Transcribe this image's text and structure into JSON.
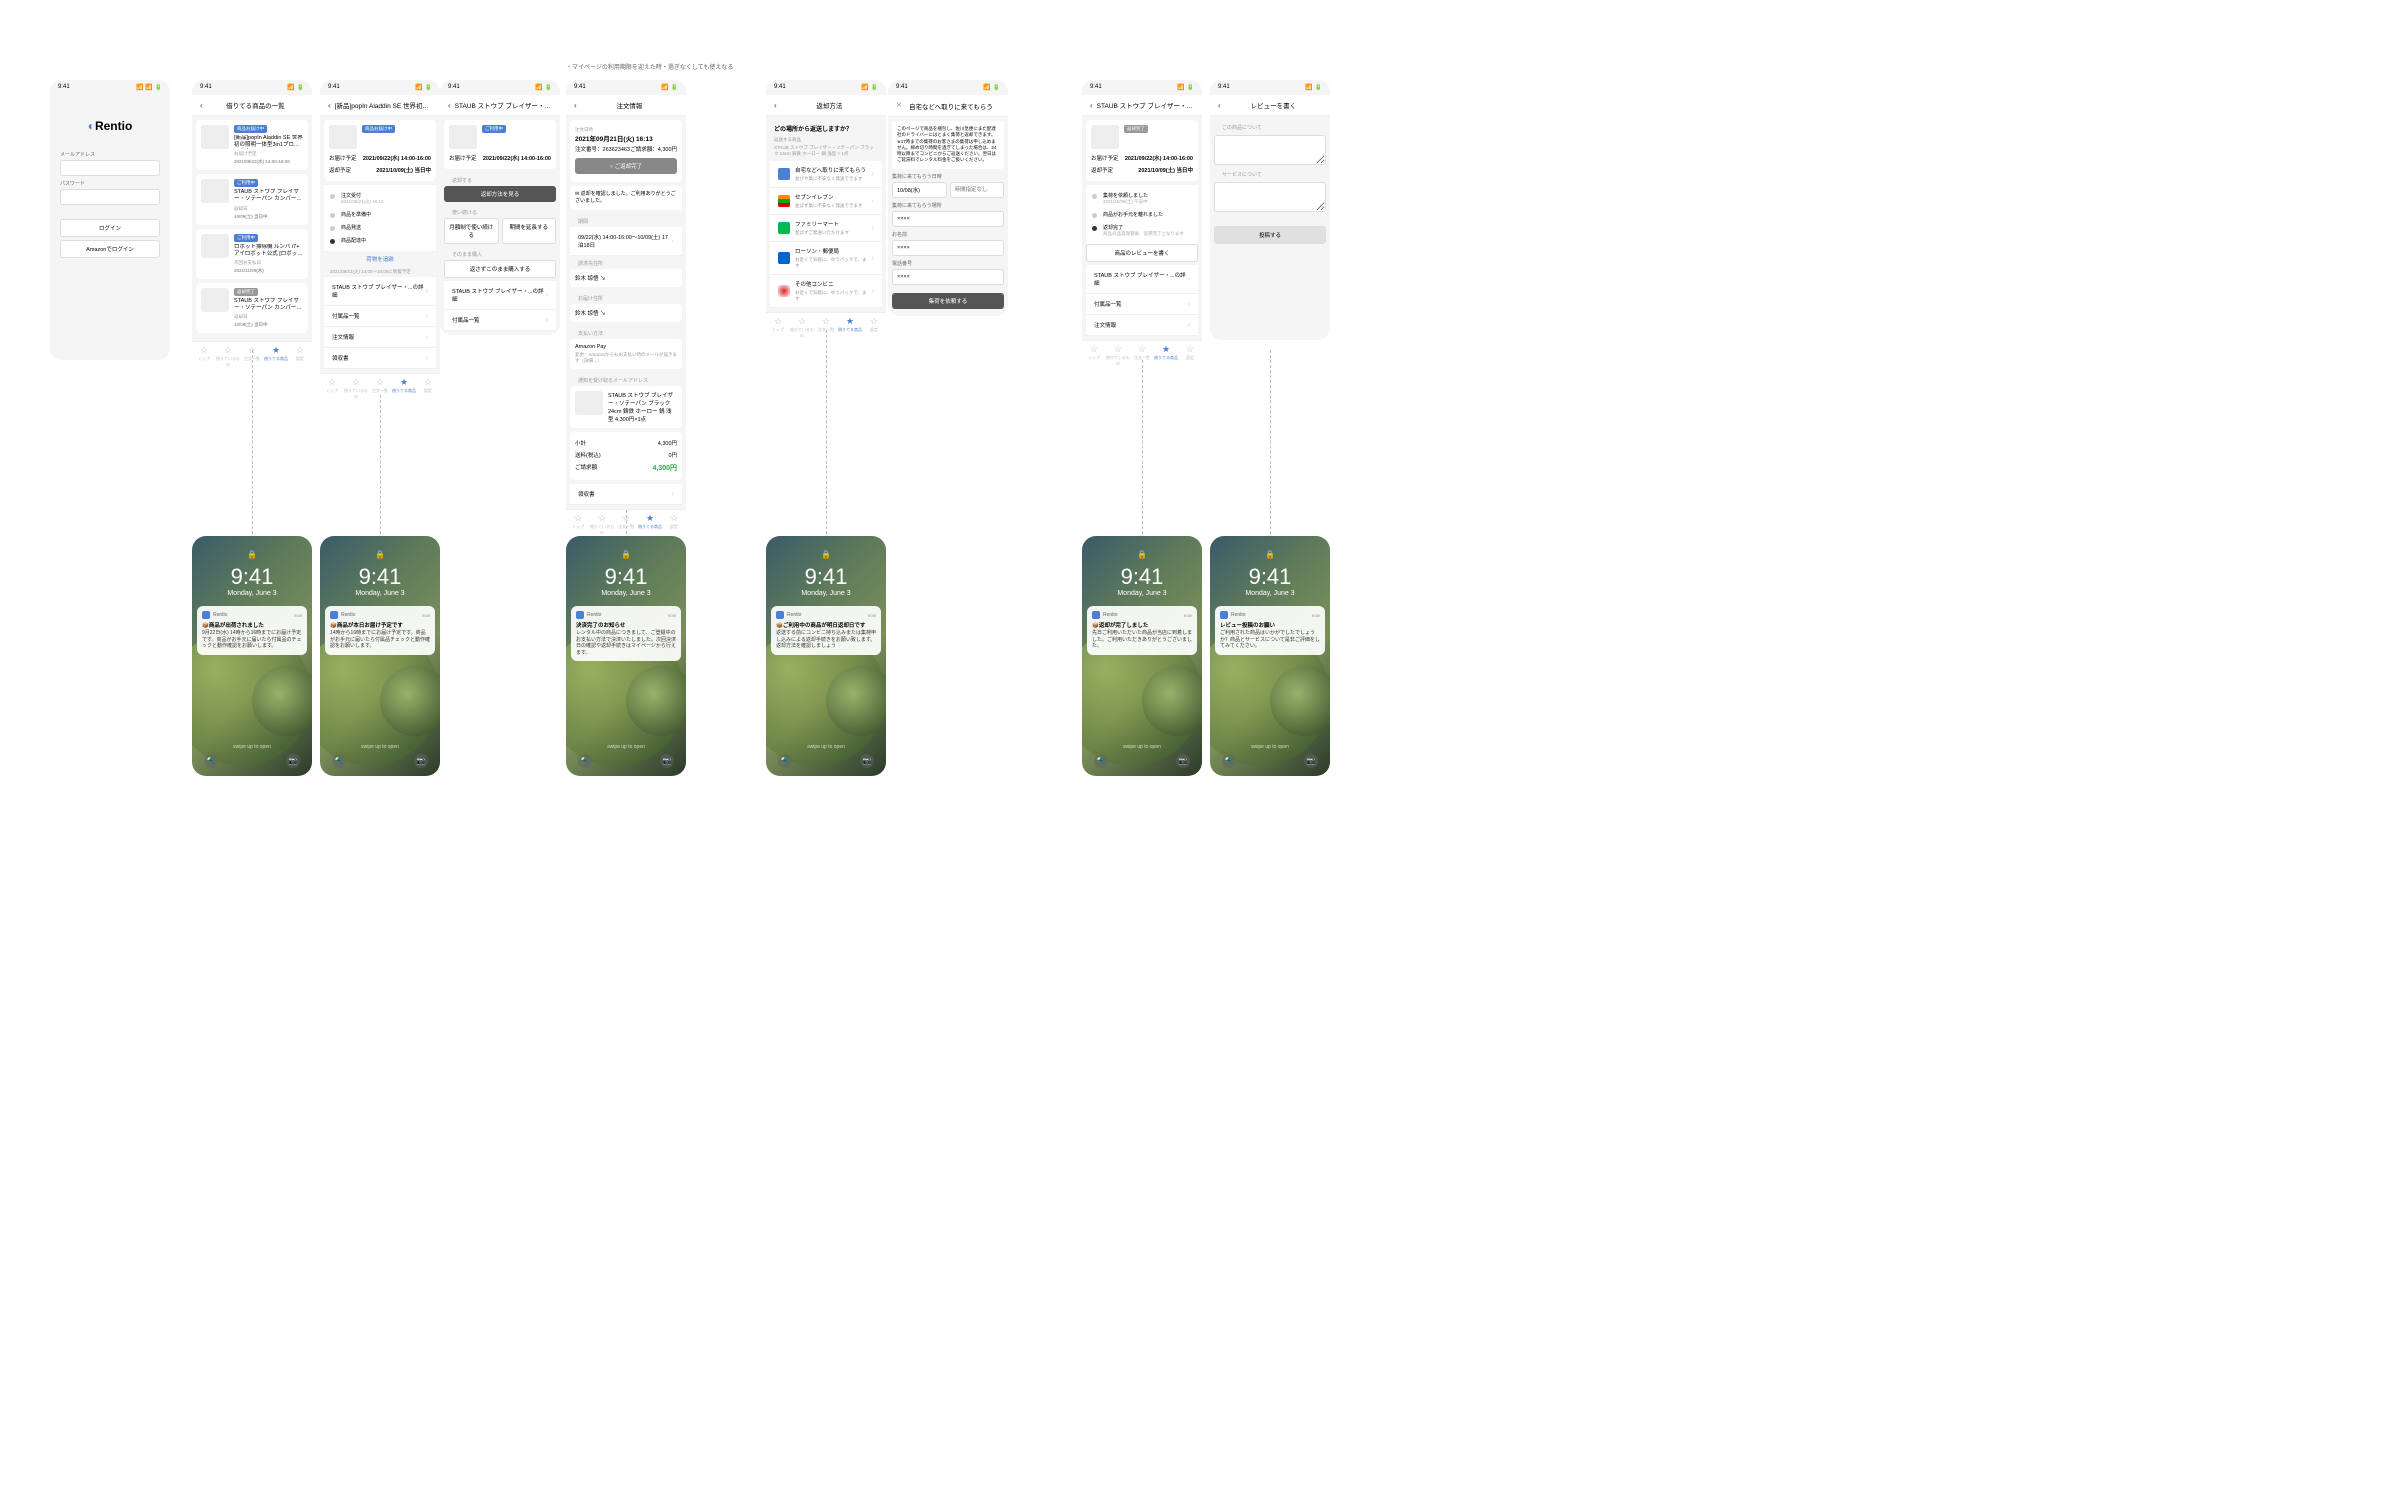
{
  "status_time": "9:41",
  "app_name": "Rentio",
  "annotation": "・マイページの利用期限を迎えた時・過ぎなくしても使えなる",
  "login": {
    "email_label": "メールアドレス",
    "password_label": "パスワード",
    "login_btn": "ログイン",
    "amazon_btn": "Amazonでログイン"
  },
  "list": {
    "title": "借りてる商品の一覧",
    "items": [
      {
        "badge": "商品お届け中",
        "name": "[新品]popIn Aladdin SE 世界初の照明一体型3in1プロジェクター PA20U02DJ",
        "sub1": "お届け予定",
        "sub2": "2021/09/22(水) 14:00-16:00"
      },
      {
        "badge": "ご利用中",
        "name": "STAUB ストウブ ブレイザー・ソテーパン カンパーニュ28c...",
        "sub1": "返却日",
        "sub2": "10/09(土) 当日中"
      },
      {
        "badge": "ご利用中",
        "name": "ロボット掃除機 ルンバ i7+ アイロボット公式 [ロボットスマー...",
        "sub1": "次回お支払日",
        "sub2": "2021/11/09(木)"
      },
      {
        "badge": "返却完了",
        "name": "STAUB ストウブ ブレイザー・ソテーパン カンパーニュ28c...",
        "sub1": "返却日",
        "sub2": "10/09(土) 当日中"
      }
    ]
  },
  "detail_a": {
    "title": "[新品]popIn Aladdin SE 世界初の照...",
    "badge": "商品お届け中",
    "deliver_label": "お届け予定",
    "deliver_val": "2021/09/22(水) 14:00-16:00",
    "return_label": "返却予定",
    "return_val": "2021/10/09(土) 当日中",
    "timeline": [
      {
        "s": "注文受付",
        "d": "2021/09/21(火) 16:13"
      },
      {
        "s": "商品を準備中",
        "d": ""
      },
      {
        "s": "商品発送",
        "d": ""
      },
      {
        "s": "商品配達中",
        "d": ""
      }
    ],
    "track": "荷物を追跡",
    "arrive": "2021/09/21(火) 14:00～16:00に到着予定",
    "more": "STAUB ストウブ ブレイザー・...の詳細",
    "accessories": "付属品一覧",
    "order_info": "注文情報",
    "receipt": "領収書"
  },
  "detail_b": {
    "title": "STAUB ストウブ ブレイザー・ソテーパ...",
    "badge": "ご利用中",
    "return_btn": "返却する",
    "return_method": "返却方法を見る",
    "continue": "使い続ける",
    "g1": "月額制で使い続ける",
    "g2": "期間を延長する",
    "buy": "そのまま購入",
    "buy_btn": "返さずこのまま購入する",
    "more": "STAUB ストウブ ブレイザー・...の詳細",
    "accessories": "付属品一覧"
  },
  "order": {
    "title": "注文情報",
    "dt_label": "注文日時",
    "dt": "2021年09月21日(火) 16:13",
    "no_label": "注文番号：",
    "no": "263623463",
    "amt_label": "ご請求額：",
    "amt": "4,300円",
    "status_btn": "○ ご返却完了",
    "thanks": "✉ 返却を確認しました。ご利用ありがとうございました。",
    "period_label": "期間",
    "period": "09/22(水) 14:00-16:00〜10/09(土) 17泊18日",
    "bill_to": "請求先住所",
    "name1": "鈴木 諒悟 ↘",
    "ship_to": "お届け住所",
    "name2": "鈴木 諒悟 ↘",
    "pay": "支払い方法",
    "pay_method": "Amazon Pay",
    "pay_note": "変更：Amazonからもお支払い時のメールが届きます（詳細→）",
    "notify": "通知を受け取るメールアドレス",
    "item": "STAUB ストウブ ブレイザー・ソテーパン ブラック 24cm 鋳鉄 ホーロー 鍋 浅型 4,300円×1点",
    "p1": "小計",
    "p1v": "4,300円",
    "p2": "送料(税込)",
    "p2v": "0円",
    "p3": "ご請求額",
    "p3v": "4,300円",
    "receipt": "領収書"
  },
  "return": {
    "title": "返却方法",
    "q": "どの場所から返送しますか？",
    "sub": "返送する商品",
    "prod": "STAUB ストウブ ブレイザー・ソテーパン ブラック 24cm 鋳鉄 ホーロー 鍋 浅型 × 1点",
    "options": [
      {
        "t": "自宅などへ取りに来てもらう",
        "s": "並びや集に不安なく発送できます"
      },
      {
        "t": "セブンイレブン",
        "s": "並ばず集に不安なく発送できます"
      },
      {
        "t": "ファミリーマート",
        "s": "並ばずご発送いただけます"
      },
      {
        "t": "ローソン・郵便局",
        "s": "お近くで気軽に、ゆうパックで、ます"
      },
      {
        "t": "その他コンビニ",
        "s": "お近くで気軽に、ゆうパックで、ます"
      }
    ]
  },
  "pickup": {
    "title": "自宅などへ取りに来てもらう",
    "desc": "このページで商品を梱包し、佐川急便にまた配達社のドライバーにはとまく集荷と返却できます。\n※17時までの集荷のお客さまの集荷は申し込めません。締め切り時間を過ぎてしまった場合は、24時以降までコンビニからご返送ください。翌日はご延滞料でレンタル料金をご扱いください。",
    "date_label": "集荷に来てもらう日時",
    "date_val": "10/08(水)",
    "time_ph": "時間指定なし",
    "place_label": "集荷に来てもらう場所",
    "place_val": "××××",
    "name_label": "お名前",
    "name_val": "××××",
    "tel_label": "電話番号",
    "tel_val": "××××",
    "submit": "集荷を依頼する"
  },
  "done": {
    "title": "STAUB ストウブ ブレイザー・ソテーパ...",
    "badge": "返却完了",
    "tl": [
      {
        "s": "集荷を依頼しました",
        "d": "2021/10/09(土) 午前中"
      },
      {
        "s": "商品がお手元を離れました",
        "d": ""
      },
      {
        "s": "返却完了",
        "d": "商品の品質保管後、実際完了となります"
      }
    ],
    "review": "商品のレビューを書く",
    "more": "STAUB ストウブ ブレイザー・...の詳細",
    "accessories": "付属品一覧",
    "order_info": "注文情報"
  },
  "review": {
    "title": "レビューを書く",
    "s1": "この商品について",
    "s2": "サービスについて",
    "submit": "投稿する"
  },
  "lock": {
    "time": "9:41",
    "date": "Monday, June 3",
    "swipe": "swipe up to open",
    "now": "now"
  },
  "notifs": [
    {
      "title": "📦商品が出荷されました",
      "body": "9月22日(水) 14時から16時までにお届け予定です。商品がお手元に届いたら付属品のチェックと動作確認をお願いします。"
    },
    {
      "title": "📦商品が本日お届け予定です",
      "body": "14時から16時までにお届け予定です。商品がお手元に届いたら付属品チェックと動作確認をお願いします。"
    },
    {
      "title": "決済完了のお知らせ",
      "body": "レンタル中の商品につきまして、ご登録中のお支払い方法で決済いたしました。次回決済日の確認や返却手続きはマイページから行えます。"
    },
    {
      "title": "📦ご利用中の商品が明日返却日です",
      "body": "返送する前にコンビニ持ち込みまたは集荷申し込みによる返却手続きをお願い致します。返却方法を確認しましょう"
    },
    {
      "title": "📦返却が完了しました",
      "body": "先日ご利用いただいた商品が当店に到着しました。ご利用いただきありがとうございました。"
    },
    {
      "title": "レビュー投稿のお願い",
      "body": "ご利用された商品はいかがでしたでしょうか？商品とサービスについて是非ご評価をしてみてください。"
    }
  ],
  "tabs": [
    "トップ",
    "借りているもの",
    "注文一覧",
    "借りてる商品",
    "設定"
  ]
}
